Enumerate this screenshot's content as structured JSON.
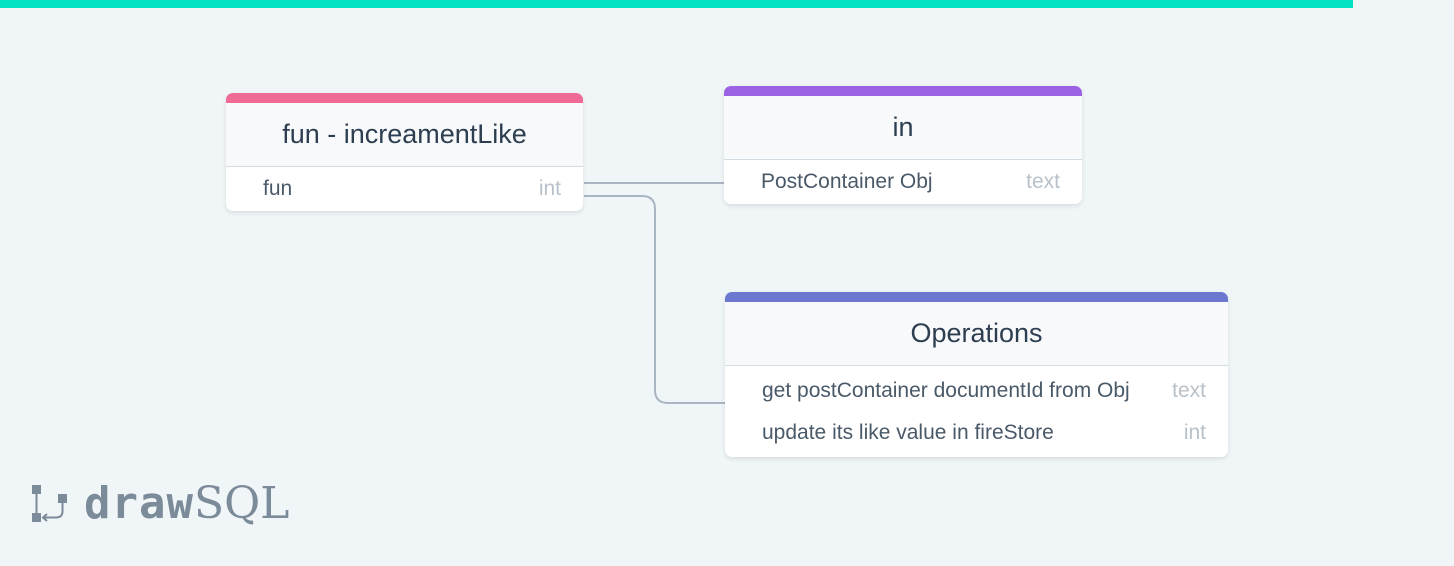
{
  "tables": {
    "fun_increament_like": {
      "title": "fun - increamentLike",
      "accent_color": "#ef6a95",
      "rows": [
        {
          "name": "fun",
          "type": "int"
        }
      ]
    },
    "in_table": {
      "title": "in",
      "accent_color": "#9b63e3",
      "rows": [
        {
          "name": "PostContainer Obj",
          "type": "text"
        }
      ]
    },
    "operations": {
      "title": "Operations",
      "accent_color": "#6c78d0",
      "rows": [
        {
          "name": "get postContainer documentId from Obj",
          "type": "text"
        },
        {
          "name": "update its like value in fireStore",
          "type": "int"
        }
      ]
    }
  },
  "relations": [
    {
      "from": "fun_increament_like.fun",
      "to": "in_table.PostContainer Obj"
    },
    {
      "from": "fun_increament_like.fun",
      "to": "operations.get postContainer documentId from Obj"
    }
  ],
  "branding": {
    "logo_draw": "draw",
    "logo_sql": "SQL",
    "top_accent_color": "#00e2c2"
  }
}
